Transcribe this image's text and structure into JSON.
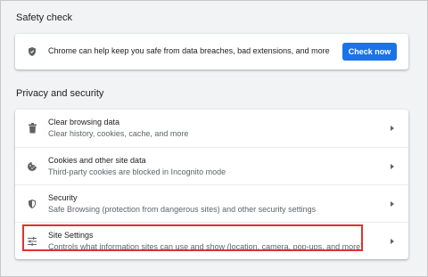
{
  "safety_check": {
    "title": "Safety check",
    "message": "Chrome can help keep you safe from data breaches, bad extensions, and more",
    "button_label": "Check now",
    "icon": "shield-check-icon"
  },
  "privacy": {
    "title": "Privacy and security",
    "items": [
      {
        "title": "Clear browsing data",
        "subtitle": "Clear history, cookies, cache, and more",
        "icon": "trash-icon"
      },
      {
        "title": "Cookies and other site data",
        "subtitle": "Third-party cookies are blocked in Incognito mode",
        "icon": "cookie-icon"
      },
      {
        "title": "Security",
        "subtitle": "Safe Browsing (protection from dangerous sites) and other security settings",
        "icon": "shield-icon"
      },
      {
        "title": "Site Settings",
        "subtitle": "Controls what information sites can use and show (location, camera, pop-ups, and more)",
        "icon": "sliders-icon"
      }
    ]
  },
  "colors": {
    "accent": "#1a73e8",
    "highlight": "#e03131",
    "background": "#f1f3f4"
  }
}
